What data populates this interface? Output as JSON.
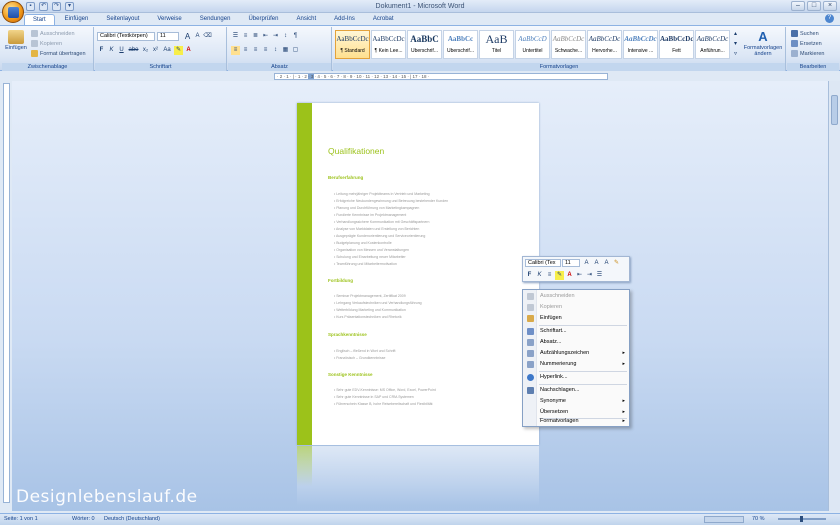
{
  "window": {
    "title": "Dokument1 - Microsoft Word"
  },
  "qat": [
    "save-icon",
    "undo-icon",
    "redo-icon",
    "customize-icon"
  ],
  "tabs": [
    "Start",
    "Einfügen",
    "Seitenlayout",
    "Verweise",
    "Sendungen",
    "Überprüfen",
    "Ansicht",
    "Add-Ins",
    "Acrobat"
  ],
  "ribbon": {
    "clipboard": {
      "paste": "Einfügen",
      "cut": "Ausschneiden",
      "copy": "Kopieren",
      "format_painter": "Format übertragen",
      "label": "Zwischenablage"
    },
    "font": {
      "name": "Calibri (Textkörpen)",
      "size": "11",
      "label": "Schriftart",
      "bold": "F",
      "italic": "K",
      "underline": "U",
      "strike": "abe",
      "sub": "x₂",
      "sup": "x²",
      "case": "Aa",
      "grow": "A",
      "shrink": "A"
    },
    "paragraph": {
      "label": "Absatz",
      "pilcrow": "¶"
    },
    "styles": {
      "label": "Formatvorlagen",
      "items": [
        {
          "preview": "AaBbCcDc",
          "name": "¶ Standard"
        },
        {
          "preview": "AaBbCcDc",
          "name": "¶ Kein Lee..."
        },
        {
          "preview": "AaBbC",
          "name": "Überschrif..."
        },
        {
          "preview": "AaBbCc",
          "name": "Überschrif..."
        },
        {
          "preview": "AaB",
          "name": "Titel"
        },
        {
          "preview": "AaBbCcD",
          "name": "Untertitel"
        },
        {
          "preview": "AaBbCcDc",
          "name": "Schwache..."
        },
        {
          "preview": "AaBbCcDc",
          "name": "Hervorhe..."
        },
        {
          "preview": "AaBbCcDc",
          "name": "Intensive ..."
        },
        {
          "preview": "AaBbCcDc",
          "name": "Fett"
        },
        {
          "preview": "AaBbCcDc",
          "name": "Anführun..."
        }
      ],
      "change": "Formatvorlagen ändern"
    },
    "editing": {
      "label": "Bearbeiten",
      "find": "Suchen",
      "replace": "Ersetzen",
      "select": "Markieren"
    }
  },
  "ruler_text": "· 2 · 1 · | · 1 · 2 · 3 · 4 · 5 · 6 · 7 · 8 · 9 · 10 · 11 · 12 · 13 · 14 · 15 · | 17 · 18 ·",
  "document": {
    "heading": "Qualifikationen",
    "sections": [
      {
        "title": "Berufserfahrung",
        "lines": [
          "• Leitung mehrjähriger Projektteams in Vertrieb und Marketing",
          "• Erfolgreiche Neukundengewinnung und Betreuung bestehender Kunden",
          "• Planung und Durchführung von Marketingkampagnen",
          "• Fundierte Kenntnisse im Projektmanagement",
          "• Verhandlungssichere Kommunikation mit Geschäftspartnern",
          "• Analyse von Marktdaten und Erstellung von Berichten",
          "• Ausgeprägte Kundenorientierung und Serviceorientierung",
          "• Budgetplanung und Kostenkontrolle",
          "• Organisation von Messen und Veranstaltungen",
          "• Schulung und Einarbeitung neuer Mitarbeiter",
          "• Teamführung und Mitarbeitermotivation"
        ]
      },
      {
        "title": "Fortbildung",
        "lines": [
          "• Seminar Projektmanagement, Zertifikat 2009",
          "• Lehrgang Verkaufstechniken und Verhandlungsführung",
          "• Weiterbildung Marketing und Kommunikation",
          "• Kurs Präsentationstechniken und Rhetorik"
        ]
      },
      {
        "title": "Sprachkenntnisse",
        "lines": [
          "• Englisch – fließend in Wort und Schrift",
          "• Französisch – Grundkenntnisse"
        ]
      },
      {
        "title": "Sonstige Kenntnisse",
        "lines": [
          "• Sehr gute EDV-Kenntnisse: MS Office, Word, Excel, PowerPoint",
          "• Sehr gute Kenntnisse in SAP und CRM-Systemen",
          "• Führerschein Klasse B, hohe Reisebereitschaft und Flexibilität"
        ]
      }
    ]
  },
  "minitoolbar": {
    "font": "Calibri (Tex",
    "size": "11",
    "bold": "F",
    "italic": "K"
  },
  "context_menu": [
    {
      "label": "Ausschneiden",
      "disabled": true,
      "submenu": false
    },
    {
      "label": "Kopieren",
      "disabled": true,
      "submenu": false
    },
    {
      "label": "Einfügen",
      "disabled": false,
      "submenu": false
    },
    {
      "label": "Schriftart...",
      "disabled": false,
      "submenu": false
    },
    {
      "label": "Absatz...",
      "disabled": false,
      "submenu": false
    },
    {
      "label": "Aufzählungszeichen",
      "disabled": false,
      "submenu": true
    },
    {
      "label": "Nummerierung",
      "disabled": false,
      "submenu": true
    },
    {
      "label": "Hyperlink...",
      "disabled": false,
      "submenu": false
    },
    {
      "label": "Nachschlagen...",
      "disabled": false,
      "submenu": false
    },
    {
      "label": "Synonyme",
      "disabled": false,
      "submenu": true
    },
    {
      "label": "Übersetzen",
      "disabled": false,
      "submenu": true
    },
    {
      "label": "Formatvorlagen",
      "disabled": false,
      "submenu": true
    }
  ],
  "status": {
    "page": "Seite: 1 von 1",
    "words": "Wörter: 0",
    "lang": "Deutsch (Deutschland)",
    "zoom": "70 %"
  },
  "watermark": "Designlebenslauf.de",
  "colors": {
    "accent": "#9cc21a",
    "ribbon": "#dbe6f5"
  }
}
